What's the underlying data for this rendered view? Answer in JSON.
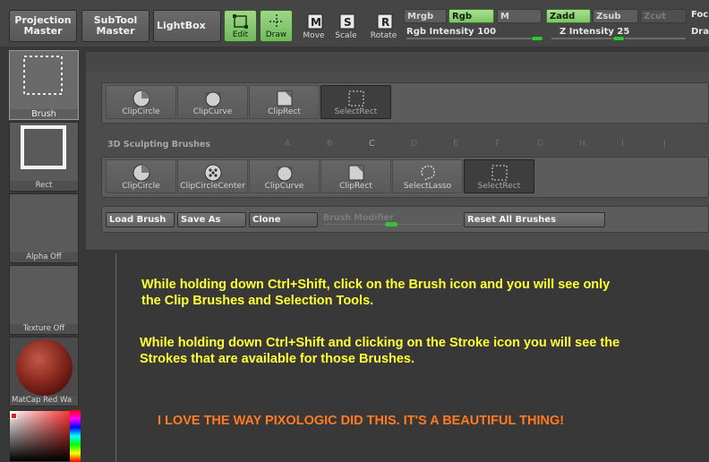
{
  "toolbar": {
    "projection_master": "Projection\nMaster",
    "subtool_master": "SubTool\nMaster",
    "lightbox": "LightBox",
    "edit": "Edit",
    "draw": "Draw",
    "move": "Move",
    "scale": "Scale",
    "rotate": "Rotate",
    "mrgb": "Mrgb",
    "rgb": "Rgb",
    "m": "M",
    "zadd": "Zadd",
    "zsub": "Zsub",
    "zcut": "Zcut",
    "focal_cut": "Foc",
    "draw_size_cut": "Dra",
    "rgb_intensity_label": "Rgb Intensity",
    "rgb_intensity_value": "100",
    "z_intensity_label": "Z Intensity",
    "z_intensity_value": "25",
    "rgb_intensity_fraction": 1.0,
    "z_intensity_fraction": 0.25
  },
  "shelf": {
    "brush": "Brush",
    "stroke": "Rect",
    "alpha": "Alpha Off",
    "texture": "Texture Off",
    "material": "MatCap Red Wa"
  },
  "clip_strip": {
    "items": [
      "ClipCircle",
      "ClipCurve",
      "ClipRect",
      "SelectRect"
    ]
  },
  "sculpt_section": {
    "title": "3D Sculpting Brushes",
    "letters": [
      "A",
      "B",
      "C",
      "D",
      "E",
      "F",
      "G",
      "H",
      "I",
      "J"
    ],
    "items": [
      "ClipCircle",
      "ClipCircleCenter",
      "ClipCurve",
      "ClipRect",
      "SelectLasso",
      "SelectRect"
    ]
  },
  "actions": {
    "load_brush": "Load Brush",
    "save_as": "Save As",
    "clone": "Clone",
    "brush_modifier": "Brush Modifier",
    "reset_all": "Reset All Brushes"
  },
  "notes": {
    "note1_line1": "While holding down Ctrl+Shift, click on the Brush icon and you will see only",
    "note1_line2": "the Clip Brushes and Selection Tools.",
    "note2_line1": "While holding down Ctrl+Shift and clicking on the Stroke icon you will see the",
    "note2_line2": "Strokes that are available for those Brushes.",
    "note3": "I LOVE THE WAY PIXOLOGIC DID THIS. IT'S A BEAUTIFUL THING!"
  },
  "colors": {
    "active_green": "#7cc466",
    "note_yellow": "#ffff33",
    "note_orange": "#ff7a20"
  }
}
